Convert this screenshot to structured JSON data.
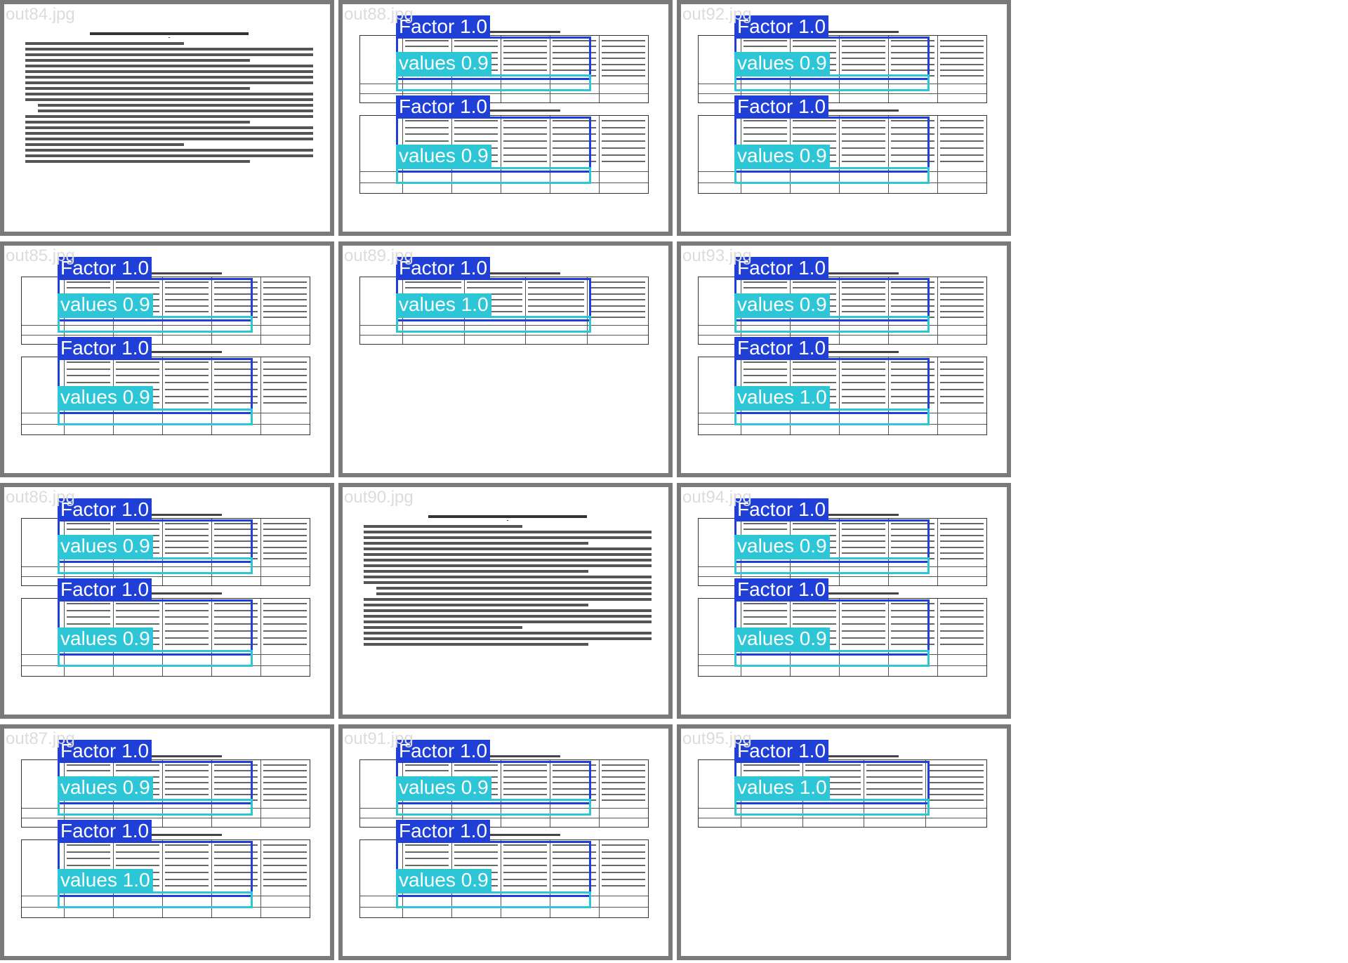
{
  "grid": {
    "tiles": [
      {
        "file": "out84.jpg",
        "kind": "text",
        "dets": []
      },
      {
        "file": "out88.jpg",
        "kind": "two",
        "dets": [
          {
            "f": "Factor 1.0",
            "v": "values 0.9"
          },
          {
            "f": "Factor 1.0",
            "v": "values 0.9"
          }
        ]
      },
      {
        "file": "out92.jpg",
        "kind": "two",
        "dets": [
          {
            "f": "Factor 1.0",
            "v": "values 0.9"
          },
          {
            "f": "Factor 1.0",
            "v": "values 0.9"
          }
        ]
      },
      {
        "file": "out85.jpg",
        "kind": "two",
        "dets": [
          {
            "f": "Factor 1.0",
            "v": "values 0.9"
          },
          {
            "f": "Factor 1.0",
            "v": "values 0.9"
          }
        ]
      },
      {
        "file": "out89.jpg",
        "kind": "one",
        "dets": [
          {
            "f": "Factor 1.0",
            "v": "values 1.0"
          }
        ]
      },
      {
        "file": "out93.jpg",
        "kind": "two",
        "dets": [
          {
            "f": "Factor 1.0",
            "v": "values 0.9"
          },
          {
            "f": "Factor 1.0",
            "v": "values 1.0"
          }
        ]
      },
      {
        "file": "out86.jpg",
        "kind": "two",
        "dets": [
          {
            "f": "Factor 1.0",
            "v": "values 0.9"
          },
          {
            "f": "Factor 1.0",
            "v": "values 0.9"
          }
        ]
      },
      {
        "file": "out90.jpg",
        "kind": "text",
        "dets": []
      },
      {
        "file": "out94.jpg",
        "kind": "two",
        "dets": [
          {
            "f": "Factor 1.0",
            "v": "values 0.9"
          },
          {
            "f": "Factor 1.0",
            "v": "values 0.9"
          }
        ]
      },
      {
        "file": "out87.jpg",
        "kind": "two",
        "dets": [
          {
            "f": "Factor 1.0",
            "v": "values 0.9"
          },
          {
            "f": "Factor 1.0",
            "v": "values 1.0"
          }
        ]
      },
      {
        "file": "out91.jpg",
        "kind": "two",
        "dets": [
          {
            "f": "Factor 1.0",
            "v": "values 0.9"
          },
          {
            "f": "Factor 1.0",
            "v": "values 0.9"
          }
        ]
      },
      {
        "file": "out95.jpg",
        "kind": "one",
        "dets": [
          {
            "f": "Factor 1.0",
            "v": "values 1.0"
          }
        ]
      }
    ]
  },
  "colors": {
    "factor": "#1f3fd6",
    "values": "#2cc6d6",
    "frame": "#7a7a7a"
  }
}
